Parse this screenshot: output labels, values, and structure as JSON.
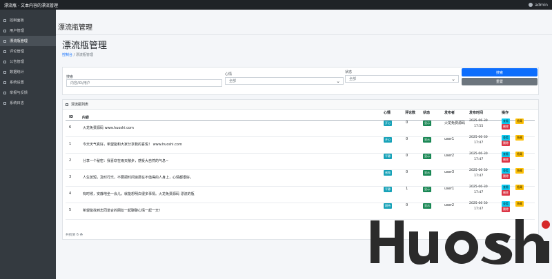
{
  "topbar": {
    "title": "漂流瓶 - 文本内容的漂流管理",
    "user_label": "admin"
  },
  "sidebar": {
    "items": [
      {
        "label": "控制面板"
      },
      {
        "label": "用户管理"
      },
      {
        "label": "漂流瓶管理"
      },
      {
        "label": "评论管理"
      },
      {
        "label": "公告管理"
      },
      {
        "label": "数据统计"
      },
      {
        "label": "系统设置"
      },
      {
        "label": "举报与反馈"
      },
      {
        "label": "系统日志"
      }
    ]
  },
  "header": {
    "heading": "漂流瓶管理",
    "page_title": "漂流瓶管理",
    "breadcrumb": [
      "控制台",
      "漂流瓶管理"
    ],
    "breadcrumb_separator": "/"
  },
  "filters": {
    "search_label": "搜索",
    "search_placeholder": "内容/ID/用户",
    "mood_label": "心情",
    "mood_value": "全部",
    "status_label": "状态",
    "status_value": "全部",
    "search_button": "搜索",
    "reset_button": "重置"
  },
  "list": {
    "title": "漂流瓶列表",
    "columns": {
      "id": "ID",
      "content": "内容",
      "mood": "心情",
      "comments": "评论数",
      "status": "状态",
      "author": "发布者",
      "time": "发布时间",
      "actions": "操作"
    },
    "rows": [
      {
        "id": "6",
        "content": "火龙免费源码 www.huoshi.com",
        "mood": "开心",
        "comments": "0",
        "status": "显示",
        "author": "火龙免费源码",
        "date": "2025-06-30",
        "time": "17:55"
      },
      {
        "id": "1",
        "content": "今天天气真好，希望能和大家分享我的喜悦！ www.huoshi.com",
        "mood": "开心",
        "comments": "0",
        "status": "显示",
        "author": "user1",
        "date": "2025-06-30",
        "time": "17:47"
      },
      {
        "id": "2",
        "content": "分享一个秘密：我喜欢在雨天散步，感受大自然的气息~",
        "mood": "平静",
        "comments": "0",
        "status": "显示",
        "author": "user2",
        "date": "2025-06-30",
        "time": "17:47"
      },
      {
        "id": "3",
        "content": "人生苦短，及时行乐，不要把时间浪费在不值得的人身上，心情都很好。",
        "mood": "感慨",
        "comments": "0",
        "status": "显示",
        "author": "user3",
        "date": "2025-06-30",
        "time": "17:47"
      },
      {
        "id": "4",
        "content": "有时候，安静地坐一会儿，就能想明白很多事情。火龙免费源码 漂流的瓶",
        "mood": "平静",
        "comments": "1",
        "status": "显示",
        "author": "user1",
        "date": "2025-06-30",
        "time": "17:47"
      },
      {
        "id": "5",
        "content": "希望能找到志同道合的朋友一起聊聊心情一起一天！",
        "mood": "期待",
        "comments": "0",
        "status": "显示",
        "author": "user2",
        "date": "2025-06-30",
        "time": "17:47"
      }
    ],
    "action_labels": {
      "view": "查看",
      "edit": "隐藏",
      "delete": "删除"
    },
    "footer": "共找到 6 条"
  },
  "watermark": {
    "text": "HuoShi"
  },
  "colors": {
    "primary": "#0d6efd",
    "secondary": "#6c757d",
    "sidebar": "#343a40",
    "topbar": "#1f2327",
    "mood_badge": "#17a2b8",
    "status_badge": "#198754",
    "danger": "#dc3545",
    "warning": "#ffc107",
    "info": "#0dcaf0",
    "watermark_dark": "#2b2b2b",
    "watermark_dot": "#d62828"
  }
}
